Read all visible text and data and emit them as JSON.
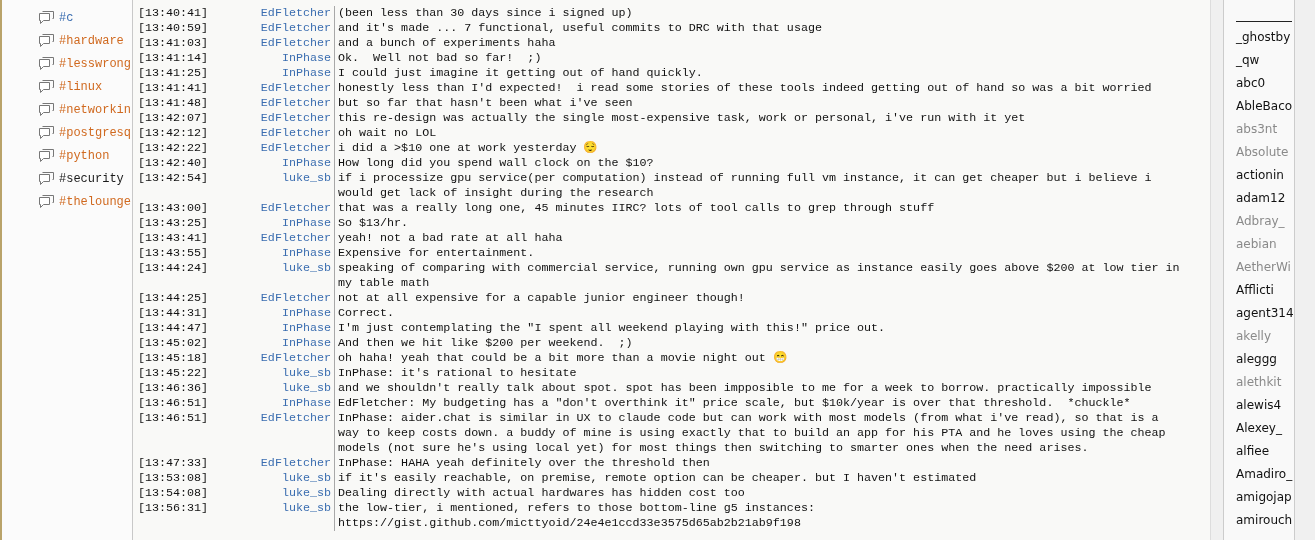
{
  "channels": [
    {
      "name": "#c",
      "color": "#3a6db0"
    },
    {
      "name": "#hardware",
      "color": "#d0691f"
    },
    {
      "name": "#lesswrong",
      "color": "#d0691f"
    },
    {
      "name": "#linux",
      "color": "#d0691f"
    },
    {
      "name": "#networkin",
      "color": "#d0691f"
    },
    {
      "name": "#postgresq",
      "color": "#d0691f"
    },
    {
      "name": "#python",
      "color": "#d0691f"
    },
    {
      "name": "#security",
      "color": "#1a1a1a"
    },
    {
      "name": "#thelounge",
      "color": "#d0691f"
    }
  ],
  "messages": [
    {
      "time": "[13:40:41]",
      "nick": "EdFletcher",
      "text": "(been less than 30 days since i signed up)"
    },
    {
      "time": "[13:40:59]",
      "nick": "EdFletcher",
      "text": "and it's made ... 7 functional, useful commits to DRC with that usage"
    },
    {
      "time": "[13:41:03]",
      "nick": "EdFletcher",
      "text": "and a bunch of experiments haha"
    },
    {
      "time": "[13:41:14]",
      "nick": "InPhase",
      "text": "Ok.  Well not bad so far!  ;)"
    },
    {
      "time": "[13:41:25]",
      "nick": "InPhase",
      "text": "I could just imagine it getting out of hand quickly."
    },
    {
      "time": "[13:41:41]",
      "nick": "EdFletcher",
      "text": "honestly less than I'd expected!  i read some stories of these tools indeed getting out of hand so was a bit worried"
    },
    {
      "time": "[13:41:48]",
      "nick": "EdFletcher",
      "text": "but so far that hasn't been what i've seen"
    },
    {
      "time": "[13:42:07]",
      "nick": "EdFletcher",
      "text": "this re-design was actually the single most-expensive task, work or personal, i've run with it yet"
    },
    {
      "time": "[13:42:12]",
      "nick": "EdFletcher",
      "text": "oh wait no LOL"
    },
    {
      "time": "[13:42:22]",
      "nick": "EdFletcher",
      "text": "i did a >$10 one at work yesterday 😌"
    },
    {
      "time": "[13:42:40]",
      "nick": "InPhase",
      "text": "How long did you spend wall clock on the $10?"
    },
    {
      "time": "[13:42:54]",
      "nick": "luke_sb",
      "text": "if i processize gpu service(per computation) instead of running full vm instance, it can get cheaper but i believe i would get lack of insight during the research"
    },
    {
      "time": "[13:43:00]",
      "nick": "EdFletcher",
      "text": "that was a really long one, 45 minutes IIRC? lots of tool calls to grep through stuff"
    },
    {
      "time": "[13:43:25]",
      "nick": "InPhase",
      "text": "So $13/hr."
    },
    {
      "time": "[13:43:41]",
      "nick": "EdFletcher",
      "text": "yeah! not a bad rate at all haha"
    },
    {
      "time": "[13:43:55]",
      "nick": "InPhase",
      "text": "Expensive for entertainment."
    },
    {
      "time": "[13:44:24]",
      "nick": "luke_sb",
      "text": "speaking of comparing with commercial service, running own gpu service as instance easily goes above $200 at low tier in my table math"
    },
    {
      "time": "[13:44:25]",
      "nick": "EdFletcher",
      "text": "not at all expensive for a capable junior engineer though!"
    },
    {
      "time": "[13:44:31]",
      "nick": "InPhase",
      "text": "Correct."
    },
    {
      "time": "[13:44:47]",
      "nick": "InPhase",
      "text": "I'm just contemplating the \"I spent all weekend playing with this!\" price out."
    },
    {
      "time": "[13:45:02]",
      "nick": "InPhase",
      "text": "And then we hit like $200 per weekend.  ;)"
    },
    {
      "time": "[13:45:18]",
      "nick": "EdFletcher",
      "text": "oh haha! yeah that could be a bit more than a movie night out 😁"
    },
    {
      "time": "[13:45:22]",
      "nick": "luke_sb",
      "text": "InPhase: it's rational to hesitate"
    },
    {
      "time": "[13:46:36]",
      "nick": "luke_sb",
      "text": "and we shouldn't really talk about spot. spot has been impposible to me for a week to borrow. practically impossible"
    },
    {
      "time": "[13:46:51]",
      "nick": "InPhase",
      "text": "EdFletcher: My budgeting has a \"don't overthink it\" price scale, but $10k/year is over that threshold.  *chuckle*"
    },
    {
      "time": "[13:46:51]",
      "nick": "EdFletcher",
      "text": "InPhase: aider.chat is similar in UX to claude code but can work with most models (from what i've read), so that is a way to keep costs down. a buddy of mine is using exactly that to build an app for his PTA and he loves using the cheap models (not sure he's using local yet) for most things then switching to smarter ones when the need arises."
    },
    {
      "time": "[13:47:33]",
      "nick": "EdFletcher",
      "text": "InPhase: HAHA yeah definitely over the threshold then"
    },
    {
      "time": "[13:53:08]",
      "nick": "luke_sb",
      "text": "if it's easily reachable, on premise, remote option can be cheaper. but I haven't estimated"
    },
    {
      "time": "[13:54:08]",
      "nick": "luke_sb",
      "text": "Dealing directly with actual hardwares has hidden cost too"
    },
    {
      "time": "[13:56:31]",
      "nick": "luke_sb",
      "text": "the low-tier, i mentioned, refers to those bottom-line g5 instances: https://gist.github.com/micttyoid/24e4e1ccd33e3575d65ab2b21ab9f198"
    }
  ],
  "users": [
    {
      "name": "_ghostby",
      "away": false
    },
    {
      "name": "_qw",
      "away": false
    },
    {
      "name": "abc0",
      "away": false
    },
    {
      "name": "AbleBaco",
      "away": false
    },
    {
      "name": "abs3nt",
      "away": true
    },
    {
      "name": "Absolute",
      "away": true
    },
    {
      "name": "actionin",
      "away": false
    },
    {
      "name": "adam12",
      "away": false
    },
    {
      "name": "Adbray_",
      "away": true
    },
    {
      "name": "aebian",
      "away": true
    },
    {
      "name": "AetherWi",
      "away": true
    },
    {
      "name": "Afflicti",
      "away": false
    },
    {
      "name": "agent314",
      "away": false
    },
    {
      "name": "akelly",
      "away": true
    },
    {
      "name": "aleggg",
      "away": false
    },
    {
      "name": "alethkit",
      "away": true
    },
    {
      "name": "alewis4",
      "away": false
    },
    {
      "name": "Alexey_",
      "away": false
    },
    {
      "name": "alfiee",
      "away": false
    },
    {
      "name": "Amadiro_",
      "away": false
    },
    {
      "name": "amigojap",
      "away": false
    },
    {
      "name": "amirouch",
      "away": false
    }
  ]
}
